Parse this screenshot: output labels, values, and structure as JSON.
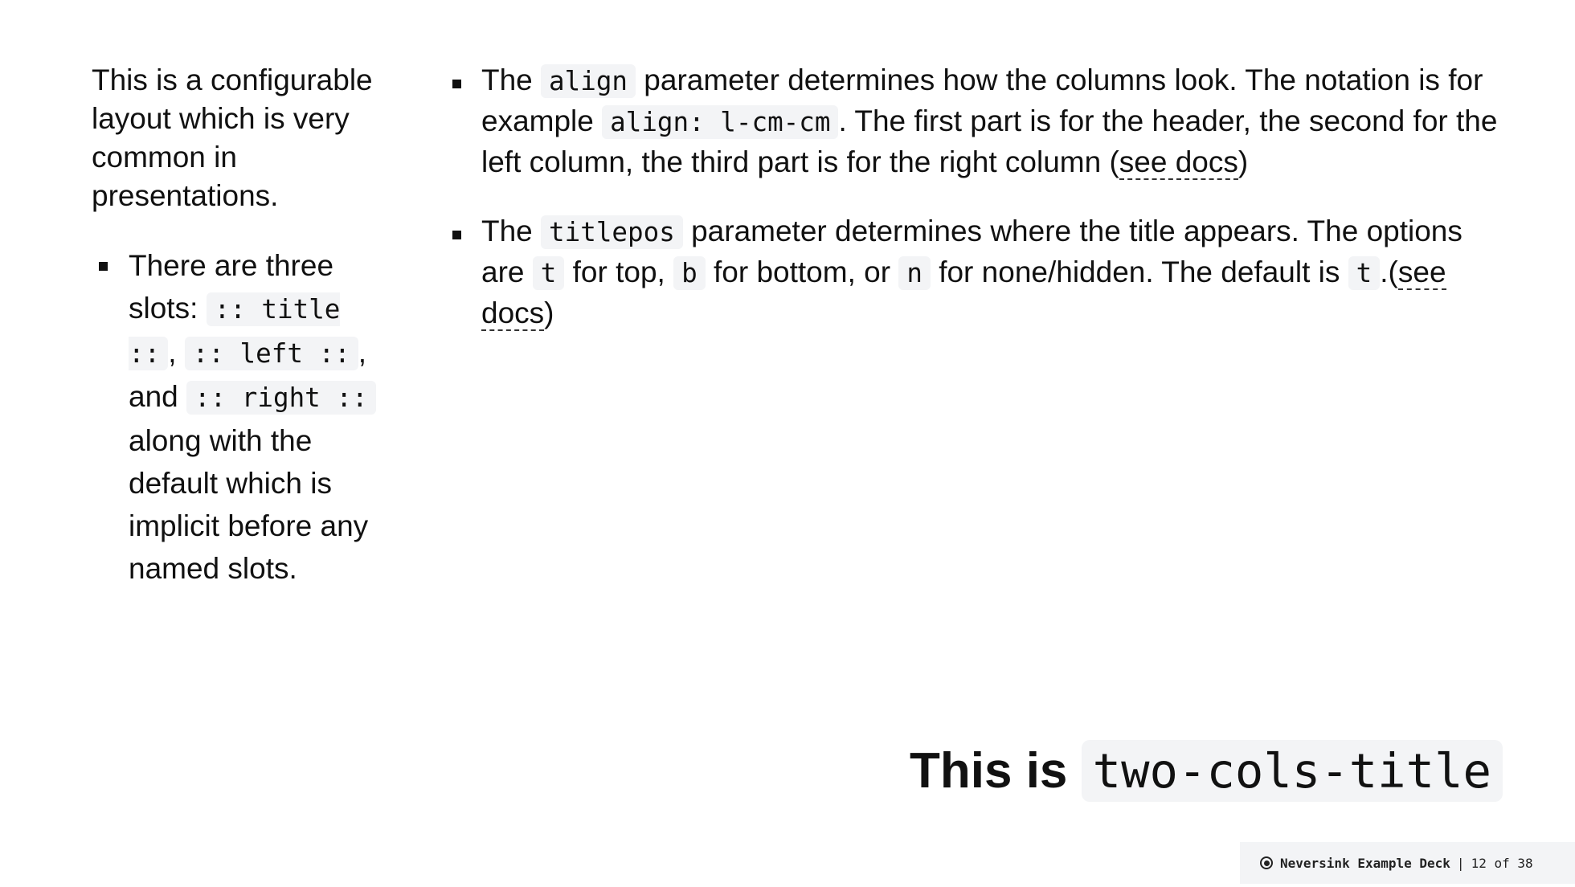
{
  "left": {
    "intro": "This is a configurable layout which is very common in presentations.",
    "bullet": {
      "t1": "There are three slots: ",
      "c1": ":: title ::",
      "t2": ", ",
      "c2": ":: left ::",
      "t3": ", and ",
      "c3": ":: right ::",
      "t4": " along with the default which is implicit before any named slots."
    }
  },
  "right": {
    "bullets": [
      {
        "t1": "The ",
        "c1": "align",
        "t2": " parameter determines how the columns look. The notation is for example ",
        "c2": "align: l-cm-cm",
        "t3": ". The first part is for the header, the second for the left column, the third part is for the right column (",
        "link": "see docs",
        "t4": ")"
      },
      {
        "t1": "The ",
        "c1": "titlepos",
        "t2": " parameter determines where the title appears. The options are ",
        "c2": "t",
        "t3": " for top, ",
        "c3": "b",
        "t4": " for bottom, or ",
        "c4": "n",
        "t5": " for none/hidden. The default is ",
        "c5": "t",
        "t6": ".(",
        "link": "see docs",
        "t7": ")"
      }
    ]
  },
  "title": {
    "text": "This is ",
    "code": "two-cols-title"
  },
  "footer": {
    "icon": "neversink-logo-icon",
    "deck": "Neversink Example Deck",
    "separator": "|",
    "page": "12 of 38"
  }
}
